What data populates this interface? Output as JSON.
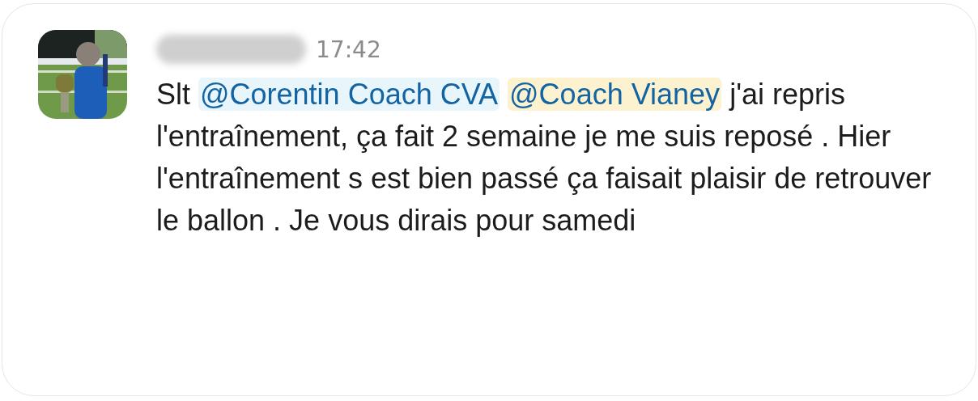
{
  "message": {
    "time": "17:42",
    "body": [
      {
        "kind": "text",
        "text": "Slt "
      },
      {
        "kind": "mention",
        "text": "@Corentin Coach CVA",
        "self": false
      },
      {
        "kind": "mention",
        "text": "@Coach Vianey",
        "self": true
      },
      {
        "kind": "text",
        "text": "j'ai repris l'entraînement, ça fait 2 semaine je me suis reposé . Hier l'entraînement s est bien passé ça faisait plaisir de retrouver le ballon . Je vous dirais pour samedi"
      }
    ]
  }
}
